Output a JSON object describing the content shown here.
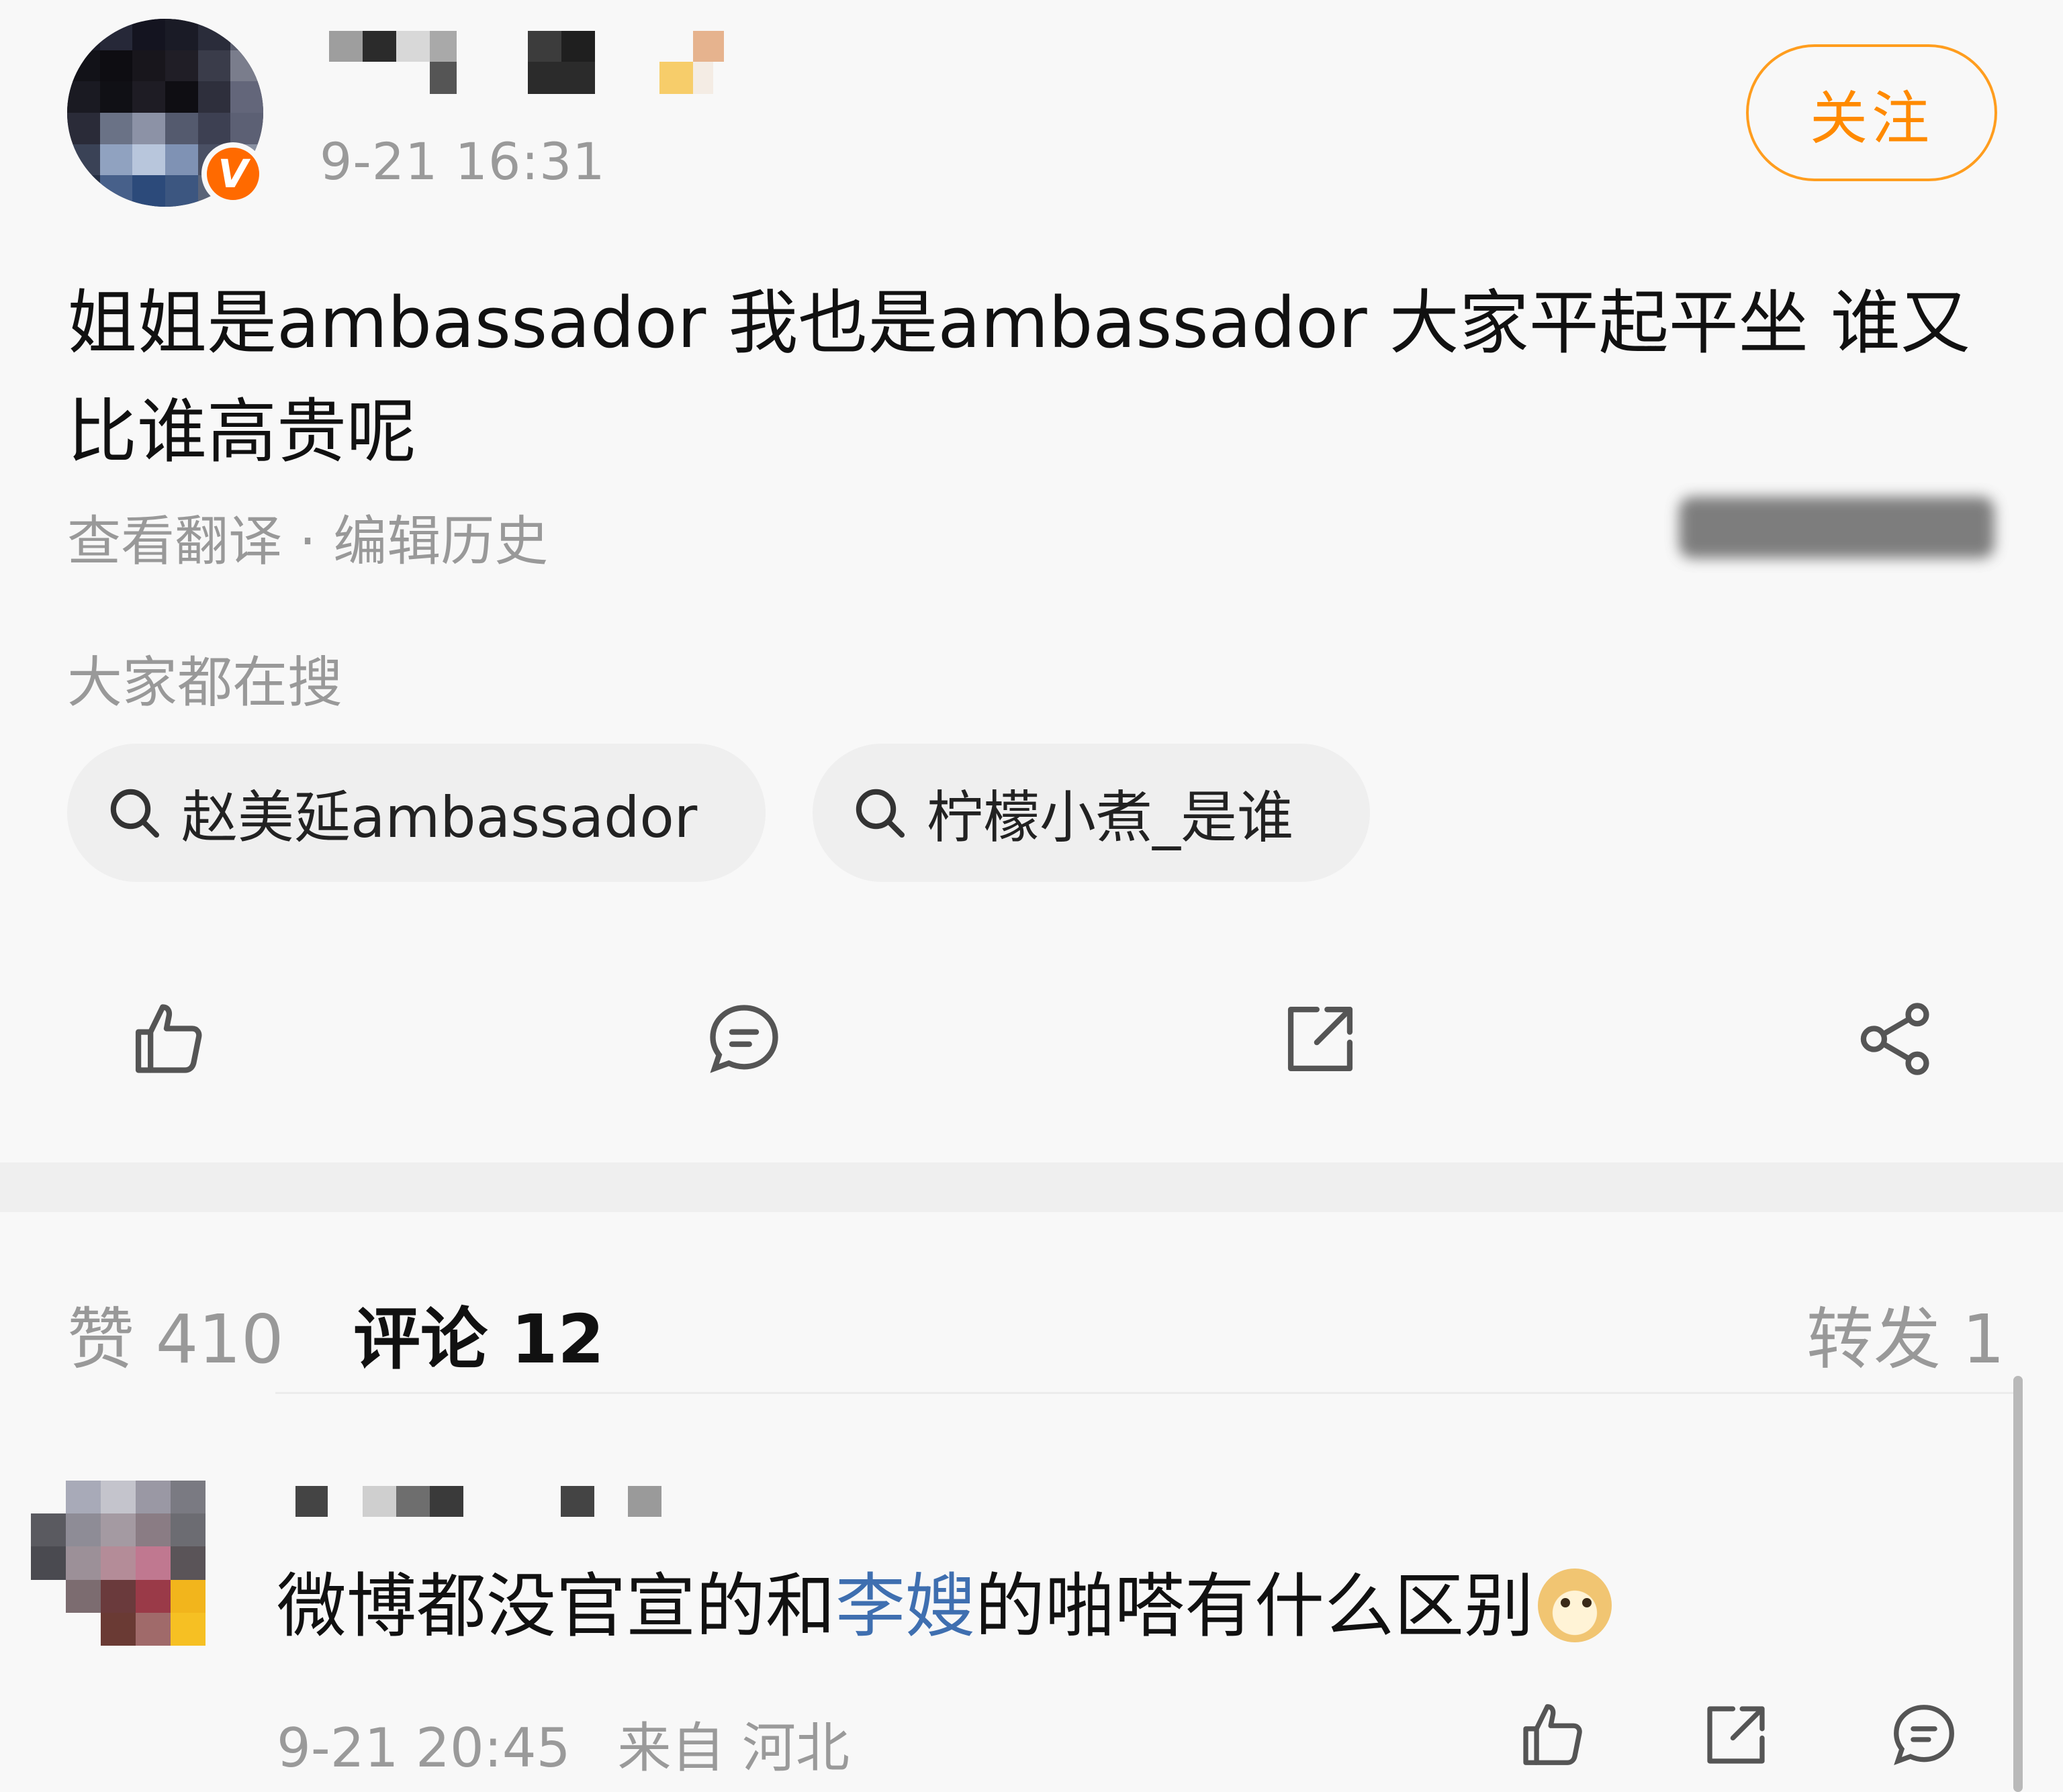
{
  "post": {
    "time": "9-21 16:31",
    "follow_label": "关注",
    "verified_mark": "V",
    "text": "姐姐是ambassador 我也是ambassador 大家平起平坐 谁又比谁高贵呢",
    "translate_label": "查看翻译",
    "meta_separator": " · ",
    "edit_history_label": "编辑历史"
  },
  "trending": {
    "title": "大家都在搜",
    "chips": [
      {
        "label": "赵美延ambassador",
        "icon": "search-icon"
      },
      {
        "label": "柠檬小煮_是谁",
        "icon": "search-icon"
      }
    ]
  },
  "actions": {
    "icons": [
      "thumbs-up-icon",
      "comment-icon",
      "repost-icon",
      "share-icon"
    ]
  },
  "tabs": {
    "likes": "赞 410",
    "comments": "评论 12",
    "reposts": "转发 1"
  },
  "comment": {
    "text_before": "微博都没官宣的和",
    "mention": "李嫂",
    "text_after": "的啪嗒有什么区别",
    "emoji": "doge-emoji",
    "time": "9-21 20:45",
    "location": "来自 河北"
  },
  "colors": {
    "accent_orange": "#ff8a00",
    "mention_blue": "#3f6fb0",
    "muted_gray": "#999999",
    "background": "#f8f8f8"
  }
}
